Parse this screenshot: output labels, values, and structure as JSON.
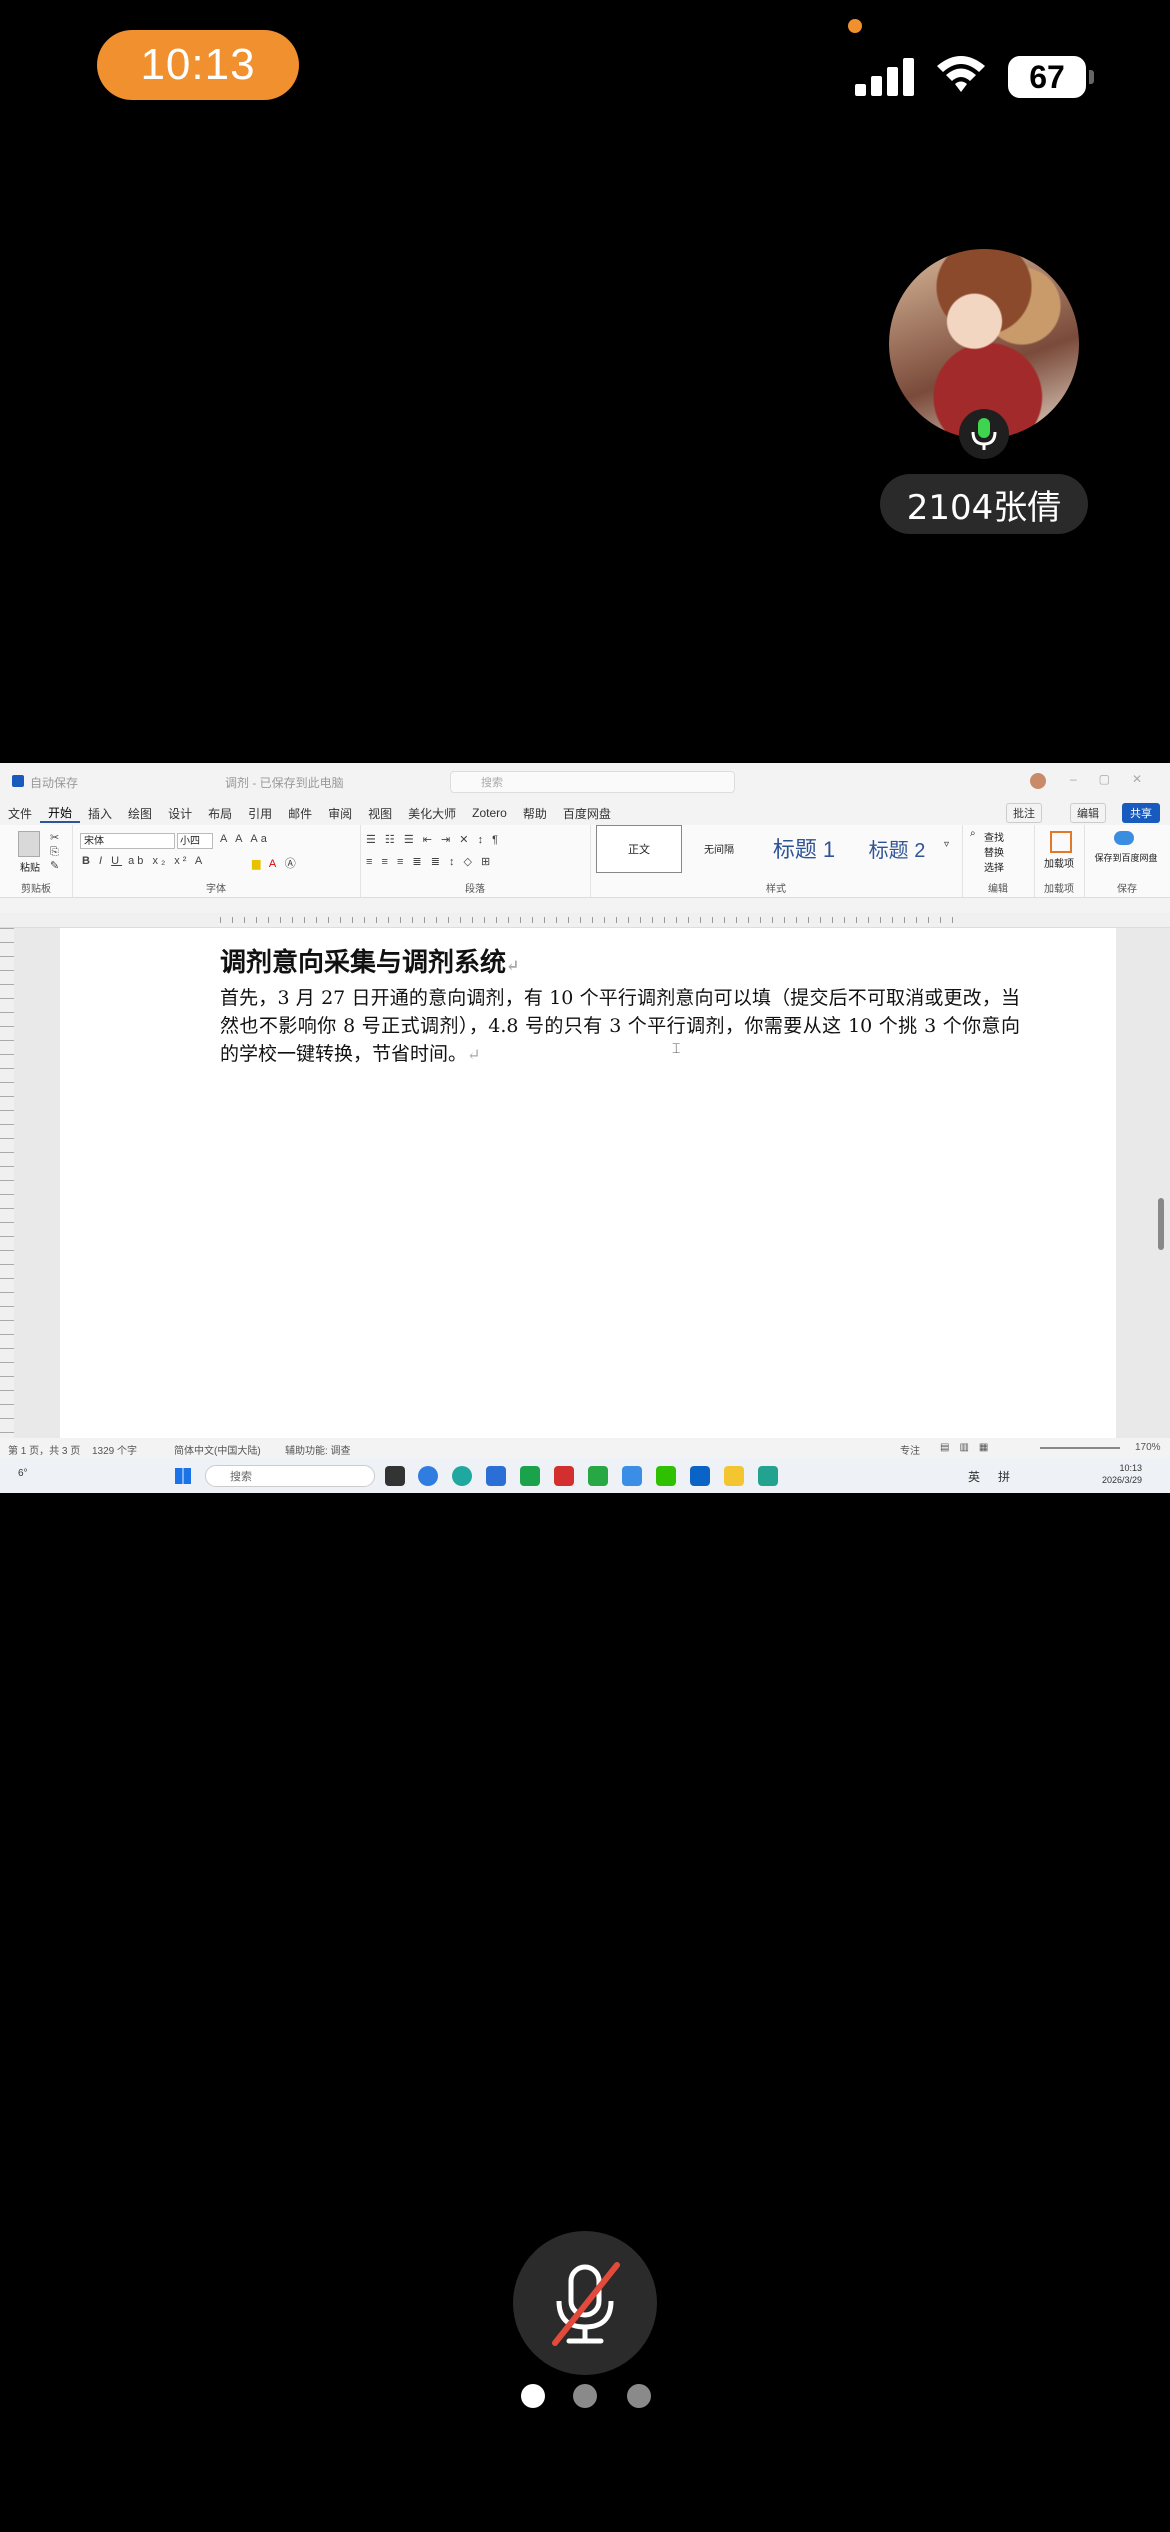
{
  "status_bar": {
    "time": "10:13",
    "battery": "67",
    "icons": [
      "signal-icon",
      "wifi-icon",
      "battery-icon"
    ]
  },
  "caller": {
    "name": "2104张倩",
    "mic_icon": "microphone-icon"
  },
  "word": {
    "window_title": "调剂 - 已保存到此电脑",
    "autosave_label": "自动保存",
    "search_placeholder": "搜索",
    "menu": [
      "文件",
      "开始",
      "插入",
      "绘图",
      "设计",
      "布局",
      "引用",
      "邮件",
      "审阅",
      "视图",
      "美化大师",
      "Zotero",
      "帮助",
      "百度网盘"
    ],
    "active_menu": "开始",
    "comment_label": "批注",
    "edit_label": "编辑",
    "share_label": "共享",
    "font_name": "宋体",
    "font_size": "小四",
    "ribbon_groups": [
      "剪贴板",
      "字体",
      "段落",
      "样式",
      "编辑",
      "加载项",
      "保存"
    ],
    "paste_label": "粘贴",
    "styles": [
      "正文",
      "无间隔",
      "标题 1",
      "标题 2"
    ],
    "edit_group_items": [
      "查找",
      "替换",
      "选择"
    ],
    "addin_label": "加载项",
    "save_to_baidu": "保存到百度网盘",
    "document": {
      "heading": "调剂意向采集与调剂系统",
      "paragraph": "首先，3 月 27 日开通的意向调剂，有 10 个平行调剂意向可以填（提交后不可取消或更改，当然也不影响你 8 号正式调剂），4.8 号的只有 3 个平行调剂，你需要从这 10 个挑 3 个你意向的学校一键转换，节省时间。"
    },
    "status": {
      "page": "第 1 页，共 3 页",
      "words": "1329 个字",
      "language": "简体中文(中国大陆)",
      "accessibility": "辅助功能: 调查",
      "focus": "专注",
      "zoom": "170%"
    },
    "taskbar": {
      "search": "搜索",
      "ime_lang": "英",
      "ime_mode": "拼",
      "clock_time": "10:13",
      "clock_date": "2026/3/29",
      "weather": "6°"
    }
  },
  "page_indicator": {
    "count": 3,
    "active": 0
  }
}
